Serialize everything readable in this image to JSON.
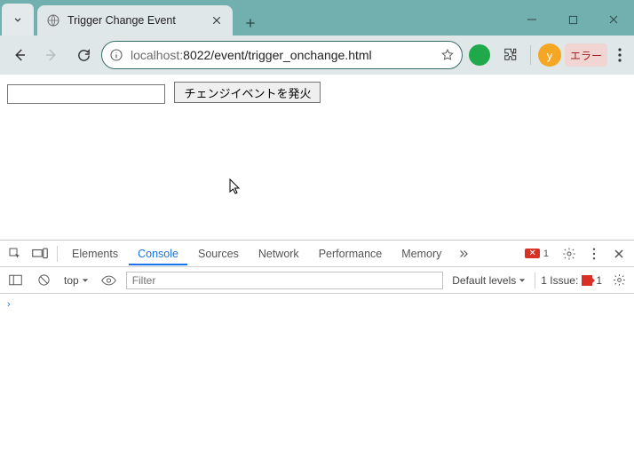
{
  "window": {
    "tab_title": "Trigger Change Event"
  },
  "toolbar": {
    "url_prefix": "localhost:",
    "url_rest": "8022/event/trigger_onchange.html",
    "avatar_letter": "y",
    "error_label": "エラー"
  },
  "page": {
    "input_value": "",
    "button_label": "チェンジイベントを発火"
  },
  "devtools": {
    "tabs": {
      "elements": "Elements",
      "console": "Console",
      "sources": "Sources",
      "network": "Network",
      "performance": "Performance",
      "memory": "Memory"
    },
    "errors_count": "1",
    "context": "top",
    "filter_placeholder": "Filter",
    "levels_label": "Default levels",
    "issue_label": "1 Issue:",
    "issue_count": "1",
    "prompt": "›"
  }
}
